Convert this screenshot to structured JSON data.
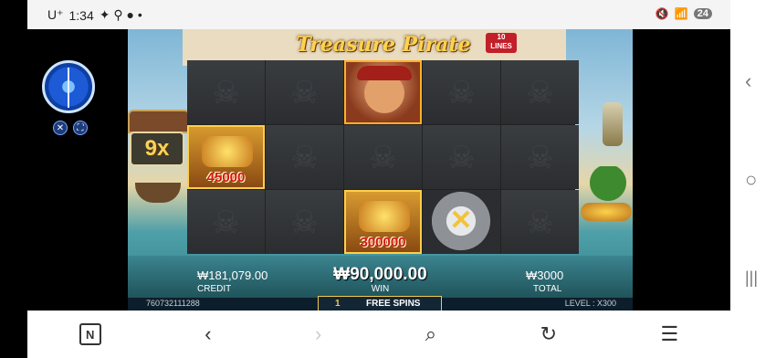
{
  "status_bar": {
    "carrier": "U⁺",
    "time": "1:34",
    "battery": "24"
  },
  "game": {
    "title": "Treasure Pirate",
    "lines_label": "10\nLINES",
    "multiplier": "9x",
    "symbols": {
      "treasure_value": "45000",
      "gold_value": "300000"
    },
    "credit_value": "₩181,079.00",
    "credit_label": "CREDIT",
    "win_value": "₩90,000.00",
    "win_label": "WIN",
    "total_value": "₩3000",
    "total_label": "TOTAL",
    "game_id": "760732111288",
    "free_spins_count": "1",
    "free_spins_label": "FREE SPINS",
    "level": "LEVEL : X300"
  },
  "side_nav": {
    "back": "‹",
    "home": "○",
    "recents": "|||"
  },
  "toolbar": {
    "n_icon": "N",
    "back": "‹",
    "forward": "›",
    "search": "⌕",
    "refresh": "↻",
    "menu": "☰"
  }
}
